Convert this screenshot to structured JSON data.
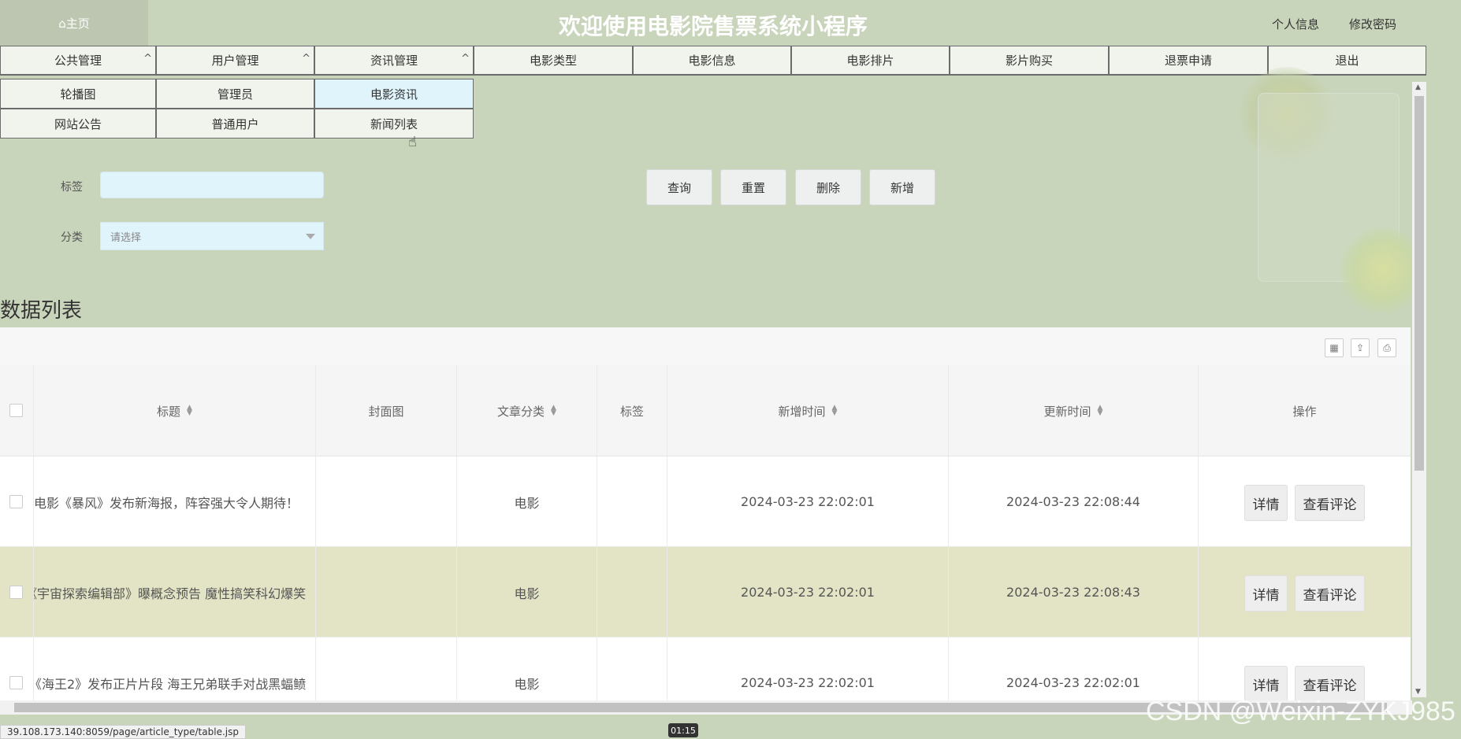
{
  "header": {
    "home": "⌂主页",
    "title": "欢迎使用电影院售票系统小程序",
    "profile": "个人信息",
    "change_password": "修改密码"
  },
  "nav": {
    "items": [
      {
        "label": "公共管理",
        "expanded": true
      },
      {
        "label": "用户管理",
        "expanded": true
      },
      {
        "label": "资讯管理",
        "expanded": true
      },
      {
        "label": "电影类型"
      },
      {
        "label": "电影信息"
      },
      {
        "label": "电影排片"
      },
      {
        "label": "影片购买"
      },
      {
        "label": "退票申请"
      },
      {
        "label": "退出"
      }
    ],
    "caret": "^",
    "submenus": {
      "public": [
        "轮播图",
        "网站公告"
      ],
      "users": [
        "管理员",
        "普通用户"
      ],
      "news": [
        "电影资讯",
        "新闻列表"
      ]
    }
  },
  "search": {
    "tag_label": "标签",
    "category_label": "分类",
    "category_placeholder": "请选择",
    "buttons": [
      "查询",
      "重置",
      "删除",
      "新增"
    ]
  },
  "list": {
    "title": "数据列表",
    "columns": [
      "标题",
      "封面图",
      "文章分类",
      "标签",
      "新增时间",
      "更新时间",
      "操作"
    ],
    "rows": [
      {
        "title": "电影《暴风》发布新海报，阵容强大令人期待！",
        "category": "电影",
        "created": "2024-03-23 22:02:01",
        "updated": "2024-03-23 22:08:44"
      },
      {
        "title": "《宇宙探索编辑部》曝概念预告 魔性搞笑科幻爆笑",
        "category": "电影",
        "created": "2024-03-23 22:02:01",
        "updated": "2024-03-23 22:08:43"
      },
      {
        "title": "《海王2》发布正片片段 海王兄弟联手对战黑蝠鲼",
        "category": "电影",
        "created": "2024-03-23 22:02:01",
        "updated": "2024-03-23 22:02:01"
      }
    ],
    "detail_label": "详情",
    "comments_label": "查看评论"
  },
  "status_url": "39.108.173.140:8059/page/article_type/table.jsp",
  "time_badge": "01:15",
  "watermark": "CSDN @Weixin-ZYKJ985",
  "colors": {
    "background": "#c9d5bb",
    "nav_item": "#f0f4ec",
    "input": "#e0f4fc",
    "row_highlight": "#e3e4c5"
  }
}
